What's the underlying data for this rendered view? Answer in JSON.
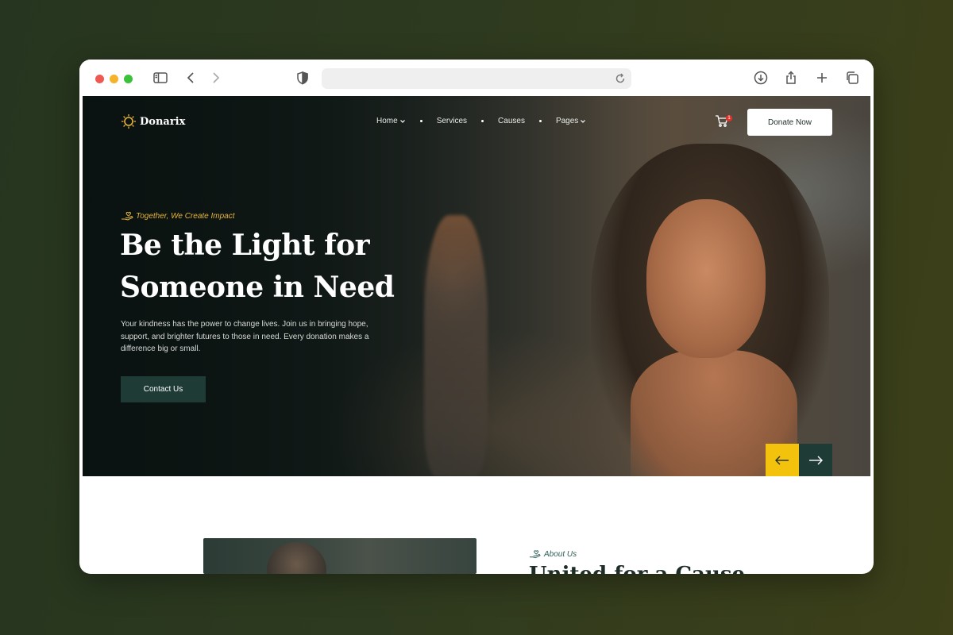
{
  "browser": {
    "url": "",
    "icons": [
      "sidebar-icon",
      "back-icon",
      "forward-icon",
      "shield-icon",
      "reload-icon",
      "download-icon",
      "share-icon",
      "new-tab-icon",
      "tabs-overview-icon"
    ]
  },
  "site": {
    "brand": "Donarix",
    "nav": [
      {
        "label": "Home",
        "dropdown": true
      },
      {
        "label": "Services",
        "dropdown": false
      },
      {
        "label": "Causes",
        "dropdown": false
      },
      {
        "label": "Pages",
        "dropdown": true
      }
    ],
    "cart_badge": "1",
    "donate_label": "Donate Now"
  },
  "hero": {
    "tagline": "Together, We Create Impact",
    "title": "Be the Light for Someone in Need",
    "description": "Your kindness has the power to change lives. Join us in bringing hope, support, and brighter futures to those in need. Every donation makes a difference big or small.",
    "cta_label": "Contact Us"
  },
  "about": {
    "tag": "About Us",
    "heading": "United for a Cause"
  },
  "colors": {
    "accent_yellow": "#f3c20d",
    "brand_dark_green": "#1f3b36",
    "tagline_gold": "#e5b33a",
    "about_tag_green": "#2f5f57"
  }
}
